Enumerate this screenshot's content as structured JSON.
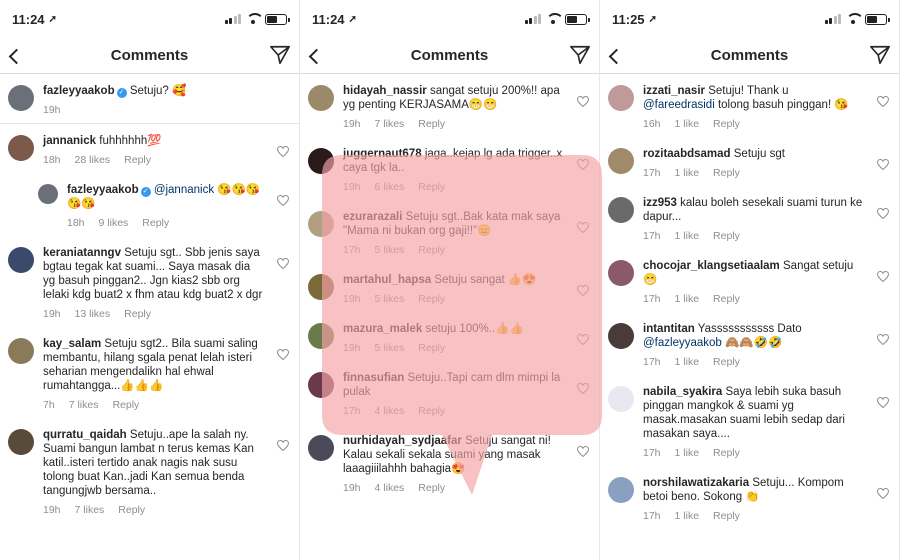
{
  "panels": [
    {
      "status_time": "11:24",
      "title": "Comments",
      "comments": [
        {
          "user": "fazleyyaakob",
          "verified": true,
          "text": "Setuju? 🥰",
          "time": "19h",
          "likes": "",
          "reply": "",
          "avatar_color": "#6b6f78",
          "heart": false,
          "reply_indent": false,
          "sep": true
        },
        {
          "user": "jannanick",
          "verified": false,
          "text": "fuhhhhhh💯",
          "time": "18h",
          "likes": "28 likes",
          "reply": "Reply",
          "avatar_color": "#7b5a4a",
          "heart": true,
          "reply_indent": false,
          "sep": false
        },
        {
          "user": "fazleyyaakob",
          "verified": true,
          "mention": "@jannanick",
          "text": " 😘😘😘😘😘",
          "time": "18h",
          "likes": "9 likes",
          "reply": "Reply",
          "avatar_color": "#6b6f78",
          "heart": true,
          "reply_indent": true,
          "sep": false
        },
        {
          "user": "keraniatanngv",
          "verified": false,
          "text": "Setuju sgt.. Sbb jenis saya bgtau tegak kat suami... Saya masak dia yg basuh pinggan2.. Jgn kias2 sbb org lelaki kdg buat2 x fhm atau kdg buat2 x dgr",
          "time": "19h",
          "likes": "13 likes",
          "reply": "Reply",
          "avatar_color": "#3a4a6a",
          "heart": true,
          "reply_indent": false,
          "sep": false
        },
        {
          "user": "kay_salam",
          "verified": false,
          "text": "Setuju sgt2.. Bila suami saling membantu, hilang sgala penat lelah isteri seharian mengendalikn hal ehwal rumahtangga...👍👍👍",
          "time": "7h",
          "likes": "7 likes",
          "reply": "Reply",
          "avatar_color": "#8a7a5a",
          "heart": true,
          "reply_indent": false,
          "sep": false
        },
        {
          "user": "qurratu_qaidah",
          "verified": false,
          "text": "Setuju..ape la salah ny. Suami bangun lambat n terus kemas Kan katil..isteri tertido anak nagis nak susu tolong buat Kan..jadi Kan semua benda tangungjwb bersama..",
          "time": "19h",
          "likes": "7 likes",
          "reply": "Reply",
          "avatar_color": "#5a4a3a",
          "heart": true,
          "reply_indent": false,
          "sep": false
        }
      ]
    },
    {
      "status_time": "11:24",
      "title": "Comments",
      "comments": [
        {
          "user": "hidayah_nassir",
          "verified": false,
          "text": "sangat setuju 200%!! apa yg penting KERJASAMA😁😁",
          "time": "19h",
          "likes": "7 likes",
          "reply": "Reply",
          "avatar_color": "#9a8a6a",
          "heart": true,
          "reply_indent": false,
          "sep": false
        },
        {
          "user": "juggernaut678",
          "verified": false,
          "text": "jaga..kejap lg ada trigger..x caya tgk la..",
          "time": "19h",
          "likes": "6 likes",
          "reply": "Reply",
          "avatar_color": "#2a1a1a",
          "heart": true,
          "reply_indent": false,
          "sep": false
        },
        {
          "user": "ezurarazali",
          "verified": false,
          "text": "Setuju sgt..Bak kata mak saya \"Mama ni bukan org gaji!!\"😑",
          "time": "17h",
          "likes": "5 likes",
          "reply": "Reply",
          "avatar_color": "#b0a080",
          "heart": true,
          "reply_indent": false,
          "sep": false
        },
        {
          "user": "martahul_hapsa",
          "verified": false,
          "text": "Setuju sangat 👍😍",
          "time": "19h",
          "likes": "5 likes",
          "reply": "Reply",
          "avatar_color": "#7a6a3a",
          "heart": true,
          "reply_indent": false,
          "sep": false
        },
        {
          "user": "mazura_malek",
          "verified": false,
          "text": "setuju 100%..👍👍",
          "time": "19h",
          "likes": "5 likes",
          "reply": "Reply",
          "avatar_color": "#6a7a4a",
          "heart": true,
          "reply_indent": false,
          "sep": false
        },
        {
          "user": "finnasufian",
          "verified": false,
          "text": "Setuju..Tapi cam dlm mimpi la pulak",
          "time": "17h",
          "likes": "4 likes",
          "reply": "Reply",
          "avatar_color": "#6a3a4a",
          "heart": true,
          "reply_indent": false,
          "sep": false
        },
        {
          "user": "nurhidayah_sydjaafar",
          "verified": false,
          "text": "Setuju sangat ni! Kalau sekali sekala suami yang masak laaagiiilahhh bahagia😍",
          "time": "19h",
          "likes": "4 likes",
          "reply": "Reply",
          "avatar_color": "#4a4a5a",
          "heart": true,
          "reply_indent": false,
          "sep": false
        }
      ]
    },
    {
      "status_time": "11:25",
      "title": "Comments",
      "comments": [
        {
          "user": "izzati_nasir",
          "verified": false,
          "text": "Setuju! Thank u ",
          "mention": "@fareedrasidi",
          "text2": " tolong basuh pinggan! 😘",
          "time": "16h",
          "likes": "1 like",
          "reply": "Reply",
          "avatar_color": "#c09a9a",
          "heart": true,
          "reply_indent": false,
          "sep": false
        },
        {
          "user": "rozitaabdsamad",
          "verified": false,
          "text": "Setuju sgt",
          "time": "17h",
          "likes": "1 like",
          "reply": "Reply",
          "avatar_color": "#a08a6a",
          "heart": true,
          "reply_indent": false,
          "sep": false
        },
        {
          "user": "izz953",
          "verified": false,
          "text": "kalau boleh sesekali suami turun ke dapur...",
          "time": "17h",
          "likes": "1 like",
          "reply": "Reply",
          "avatar_color": "#6a6a6a",
          "heart": true,
          "reply_indent": false,
          "sep": false
        },
        {
          "user": "chocojar_klangsetiaalam",
          "verified": false,
          "text": "Sangat setuju 😁",
          "time": "17h",
          "likes": "1 like",
          "reply": "Reply",
          "avatar_color": "#8a5a6a",
          "heart": true,
          "reply_indent": false,
          "sep": false
        },
        {
          "user": "intantitan",
          "verified": false,
          "text": "Yasssssssssss Dato ",
          "mention": "@fazleyyaakob",
          "text2": " 🙈🙈🤣🤣",
          "time": "17h",
          "likes": "1 like",
          "reply": "Reply",
          "avatar_color": "#4a3a3a",
          "heart": true,
          "reply_indent": false,
          "sep": false
        },
        {
          "user": "nabila_syakira",
          "verified": false,
          "text": "Saya lebih suka basuh pinggan mangkok & suami yg masak.masakan suami lebih sedap dari masakan saya....",
          "time": "17h",
          "likes": "1 like",
          "reply": "Reply",
          "avatar_color": "#e8e8f0",
          "heart": true,
          "reply_indent": false,
          "sep": false
        },
        {
          "user": "norshilawatizakaria",
          "verified": false,
          "text": "Setuju... Kompom betoi beno. Sokong 👏",
          "time": "17h",
          "likes": "1 like",
          "reply": "Reply",
          "avatar_color": "#8aa0c0",
          "heart": true,
          "reply_indent": false,
          "sep": false
        }
      ]
    }
  ]
}
